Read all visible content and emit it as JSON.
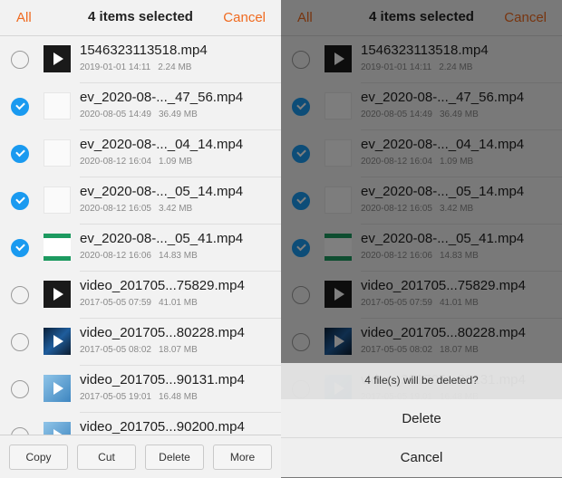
{
  "header": {
    "all_label": "All",
    "title": "4 items selected",
    "cancel_label": "Cancel"
  },
  "files": [
    {
      "name": "1546323113518.mp4",
      "date": "2019-01-01 14:11",
      "size": "2.24 MB",
      "selected": false,
      "thumb": "dark"
    },
    {
      "name": "ev_2020-08-..._47_56.mp4",
      "date": "2020-08-05 14:49",
      "size": "36.49 MB",
      "selected": true,
      "thumb": "light"
    },
    {
      "name": "ev_2020-08-..._04_14.mp4",
      "date": "2020-08-12 16:04",
      "size": "1.09 MB",
      "selected": true,
      "thumb": "light"
    },
    {
      "name": "ev_2020-08-..._05_14.mp4",
      "date": "2020-08-12 16:05",
      "size": "3.42 MB",
      "selected": true,
      "thumb": "light"
    },
    {
      "name": "ev_2020-08-..._05_41.mp4",
      "date": "2020-08-12 16:06",
      "size": "14.83 MB",
      "selected": true,
      "thumb": "green"
    },
    {
      "name": "video_201705...75829.mp4",
      "date": "2017-05-05 07:59",
      "size": "41.01 MB",
      "selected": false,
      "thumb": "dark"
    },
    {
      "name": "video_201705...80228.mp4",
      "date": "2017-05-05 08:02",
      "size": "18.07 MB",
      "selected": false,
      "thumb": "dark2"
    },
    {
      "name": "video_201705...90131.mp4",
      "date": "2017-05-05 19:01",
      "size": "16.48 MB",
      "selected": false,
      "thumb": "blue"
    },
    {
      "name": "video_201705...90200.mp4",
      "date": "",
      "size": "",
      "selected": false,
      "thumb": "blue"
    }
  ],
  "toolbar": {
    "copy": "Copy",
    "cut": "Cut",
    "delete": "Delete",
    "more": "More"
  },
  "dialog": {
    "message": "4 file(s) will be deleted?",
    "delete_label": "Delete",
    "cancel_label": "Cancel"
  },
  "colors": {
    "accent": "#f06a1f",
    "check": "#1a9af0"
  }
}
